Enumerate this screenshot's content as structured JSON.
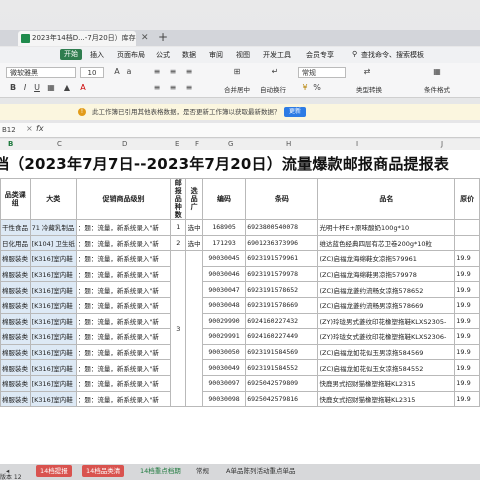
{
  "window": {
    "tab_title": "2023年14档D...-7月20日）库存",
    "tab_close": "✕",
    "tab_add": "+"
  },
  "menu": {
    "start": "开始",
    "items": [
      "插入",
      "页面布局",
      "公式",
      "数据",
      "审阅",
      "视图",
      "开发工具",
      "会员专享"
    ],
    "search": "查找命令、搜索模板"
  },
  "ribbon": {
    "font": "微软雅黑",
    "font_size": "10",
    "number_format": "常规",
    "labels": {
      "merge": "合并居中",
      "wrap": "自动换行",
      "type_convert": "类型转换",
      "conditional": "条件格式"
    }
  },
  "notice": {
    "text": "此工作簿已引用其他表格数据，是否更新工作簿以获取最新数据？",
    "button": "更新"
  },
  "formula_bar": {
    "name_box": "B12",
    "fx": "fx"
  },
  "columns": [
    "B",
    "C",
    "D",
    "E",
    "F",
    "G",
    "H",
    "I",
    "J"
  ],
  "title": "档（2023年7月7日--2023年7月20日）流量爆款邮报商品提报表",
  "table": {
    "headers": [
      "品类课组",
      "大类",
      "促销商品级别",
      "邮报品种数",
      "选品广",
      "编码",
      "条码",
      "品名",
      "原价"
    ],
    "rows": [
      {
        "a": "干性食品",
        "b": "71 冷藏乳制品",
        "c": "：题：流量，新系统录入\"新",
        "d": "1",
        "e": "选中",
        "f": "168905",
        "g": "6923800540078",
        "h": "光明十杯E+原味酸奶100g*10",
        "i": ""
      },
      {
        "a": "日化用品",
        "b": "[K104] 卫生纸",
        "c": "：题：流量，新系统录入\"新",
        "d": "2",
        "e": "选中",
        "f": "171293",
        "g": "6901236373996",
        "h": "维达蓝色经典四层有芯卫卷200g*10粒",
        "i": ""
      },
      {
        "a": "棉服装类",
        "b": "[K316]室内鞋",
        "c": "：题：流量，新系统录入\"新",
        "d": "",
        "e": "",
        "f": "90030045",
        "g": "6923191579961",
        "h": "(ZC)启福龙海绵鞋女凉拖579961",
        "i": "19.9"
      },
      {
        "a": "棉服装类",
        "b": "[K316]室内鞋",
        "c": "：题：流量，新系统录入\"新",
        "d": "",
        "e": "",
        "f": "90030046",
        "g": "6923191579978",
        "h": "(ZC)启福龙海绵鞋男凉拖579978",
        "i": "19.9"
      },
      {
        "a": "棉服装类",
        "b": "[K316]室内鞋",
        "c": "：题：流量，新系统录入\"新",
        "d": "",
        "e": "",
        "f": "90030047",
        "g": "6923191578652",
        "h": "(ZC)启福龙菱约流畅女凉拖578652",
        "i": "19.9"
      },
      {
        "a": "棉服装类",
        "b": "[K316]室内鞋",
        "c": "：题：流量，新系统录入\"新",
        "d": "",
        "e": "",
        "f": "90030048",
        "g": "6923191578669",
        "h": "(ZC)启福龙菱约流畅男凉拖578669",
        "i": "19.9"
      },
      {
        "a": "棉服装类",
        "b": "[K316]室内鞋",
        "c": "：题：流量，新系统录入\"新",
        "d": "3",
        "e": "",
        "f": "90029990",
        "g": "6924160227432",
        "h": "(ZY)玲珑男式菱纹印花橡塑拖鞋KLXS2305-",
        "i": "19.9"
      },
      {
        "a": "棉服装类",
        "b": "[K316]室内鞋",
        "c": "：题：流量，新系统录入\"新",
        "d": "",
        "e": "",
        "f": "90029991",
        "g": "6924160227449",
        "h": "(ZY)玲珑女式菱纹印花橡塑拖鞋KLXS2306-",
        "i": "19.9"
      },
      {
        "a": "棉服装类",
        "b": "[K316]室内鞋",
        "c": "：题：流量，新系统录入\"新",
        "d": "",
        "e": "",
        "f": "90030050",
        "g": "6923191584569",
        "h": "(ZC)启福龙如花似玉男凉拖584569",
        "i": "19.9"
      },
      {
        "a": "棉服装类",
        "b": "[K316]室内鞋",
        "c": "：题：流量，新系统录入\"新",
        "d": "",
        "e": "",
        "f": "90030049",
        "g": "6923191584552",
        "h": "(ZC)启福龙如花似玉女凉拖584552",
        "i": "19.9"
      },
      {
        "a": "棉服装类",
        "b": "[K316]室内鞋",
        "c": "：题：流量，新系统录入\"新",
        "d": "",
        "e": "",
        "f": "90030097",
        "g": "6925042579809",
        "h": "快鹿男式招财猫橡塑拖鞋KL2315",
        "i": "19.9"
      },
      {
        "a": "棉服装类",
        "b": "[K316]室内鞋",
        "c": "：题：流量，新系统录入\"新",
        "d": "",
        "e": "",
        "f": "90030098",
        "g": "6925042579816",
        "h": "快鹿女式招财猫橡塑拖鞋KL2315",
        "i": "19.9"
      }
    ]
  },
  "sheet_tabs": [
    "14档提报",
    "14档品类清",
    "14档重点档期",
    "常规",
    "A单品陈列活动重点单品"
  ],
  "status": "版本 12"
}
